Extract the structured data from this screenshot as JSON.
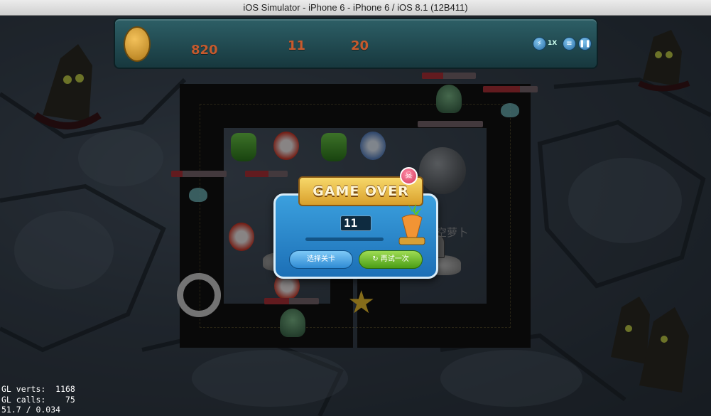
{
  "window": {
    "title": "iOS Simulator - iPhone 6 - iPhone 6 / iOS 8.1 (12B411)"
  },
  "hud": {
    "gold": "820",
    "wave_current": "11",
    "wave_total": "20",
    "speed_label": "1X",
    "icons": [
      "coin-carrot-icon",
      "speed-icon",
      "menu-icon",
      "pause-icon"
    ]
  },
  "game_over": {
    "banner": "GAME OVER",
    "wave_reached": "11",
    "select_level_label": "选择关卡",
    "retry_label": "再试一次",
    "background_hint": "空萝卜"
  },
  "debug": {
    "line1": "GL verts:  1168",
    "line2": "GL calls:    75",
    "line3": "51.7 / 0.034"
  },
  "colors": {
    "hud_bg": "#1f4a50",
    "popup_bg": "#2a86c8",
    "banner": "#e8b845",
    "retry": "#5aa81e",
    "select": "#3a98dc"
  }
}
